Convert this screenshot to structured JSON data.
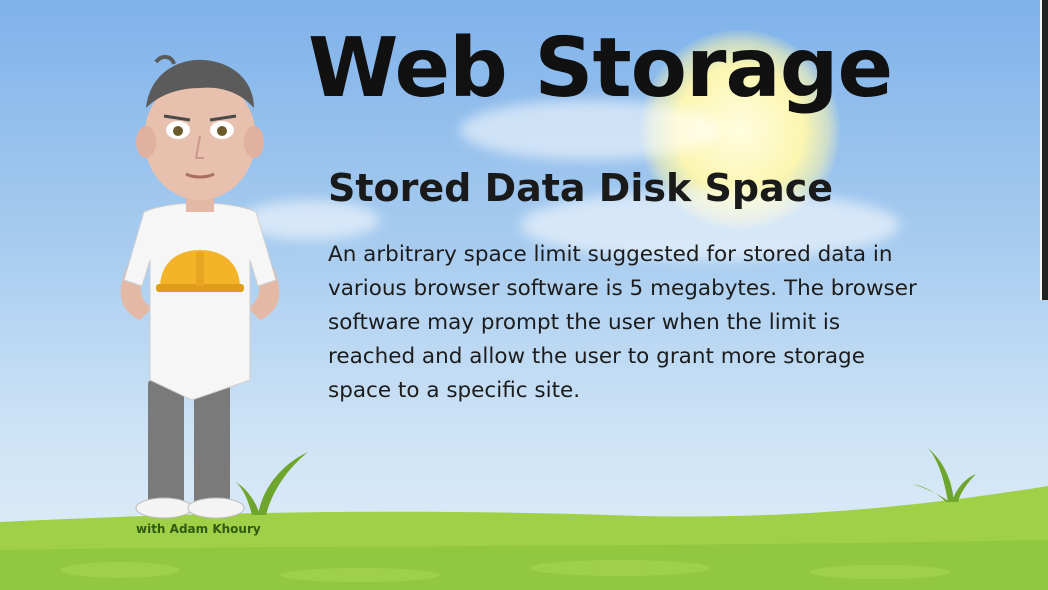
{
  "slide": {
    "title": "Web Storage",
    "subtitle": "Stored Data Disk Space",
    "body": "An arbitrary space limit suggested for stored data in various browser software is 5 megabytes. The browser software may prompt the user when the limit is reached and allow the user to grant more storage space to a specific site.",
    "credit": "with Adam Khoury"
  },
  "colors": {
    "sky_top": "#7fb2ea",
    "sky_bottom": "#e2eef8",
    "sun": "#fbf6b0",
    "grass_light": "#9fd048",
    "grass_dark": "#7fb83a",
    "title_text": "#111111",
    "hard_hat": "#f4b42a"
  },
  "icons": {
    "hard_hat": "hard-hat-icon"
  }
}
